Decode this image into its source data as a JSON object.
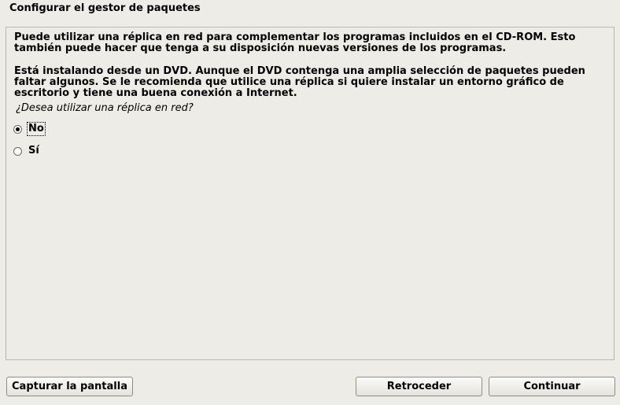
{
  "window": {
    "title": "Configurar el gestor de paquetes"
  },
  "main": {
    "paragraph1": "Puede utilizar una réplica en red para complementar los programas incluidos en el CD-ROM. Esto también puede hacer que tenga a su disposición nuevas versiones de los programas.",
    "paragraph2": "Está instalando desde un DVD. Aunque el DVD contenga una amplia selección de paquetes pueden faltar algunos. Se le recomienda que utilice una réplica si quiere instalar un entorno gráfico de escritorio y tiene una buena conexión a Internet.",
    "question": "¿Desea utilizar una réplica en red?",
    "options": [
      {
        "label": "No",
        "selected": true
      },
      {
        "label": "Sí",
        "selected": false
      }
    ]
  },
  "buttons": {
    "capture": "Capturar la pantalla",
    "back": "Retroceder",
    "continue": "Continuar"
  }
}
